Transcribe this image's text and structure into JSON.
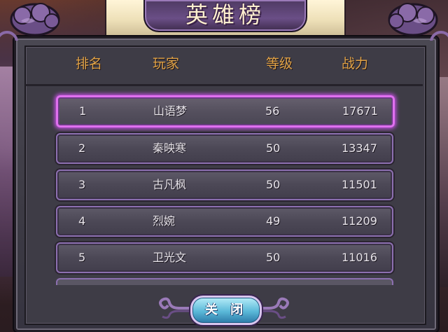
{
  "title": "英雄榜",
  "columns": {
    "rank": "排名",
    "player": "玩家",
    "level": "等级",
    "power": "战力"
  },
  "rows": [
    {
      "rank": "1",
      "player": "山语梦",
      "level": "56",
      "power": "17671",
      "selected": true
    },
    {
      "rank": "2",
      "player": "秦映寒",
      "level": "50",
      "power": "13347",
      "selected": false
    },
    {
      "rank": "3",
      "player": "古凡枫",
      "level": "50",
      "power": "11501",
      "selected": false
    },
    {
      "rank": "4",
      "player": "烈婉",
      "level": "49",
      "power": "11209",
      "selected": false
    },
    {
      "rank": "5",
      "player": "卫光文",
      "level": "50",
      "power": "11016",
      "selected": false
    }
  ],
  "close_button": {
    "label": "关 闭"
  },
  "colors": {
    "header_text": "#e0a246",
    "row_border": "#8c6fb0",
    "selected_glow": "#e070f0",
    "close_button": "#5ab8d8"
  },
  "icons": {
    "left_ornament": "purple-cloud-ornament-icon",
    "right_ornament": "purple-cloud-ornament-icon",
    "close_scroll_ends": "scroll-curl-icon"
  }
}
